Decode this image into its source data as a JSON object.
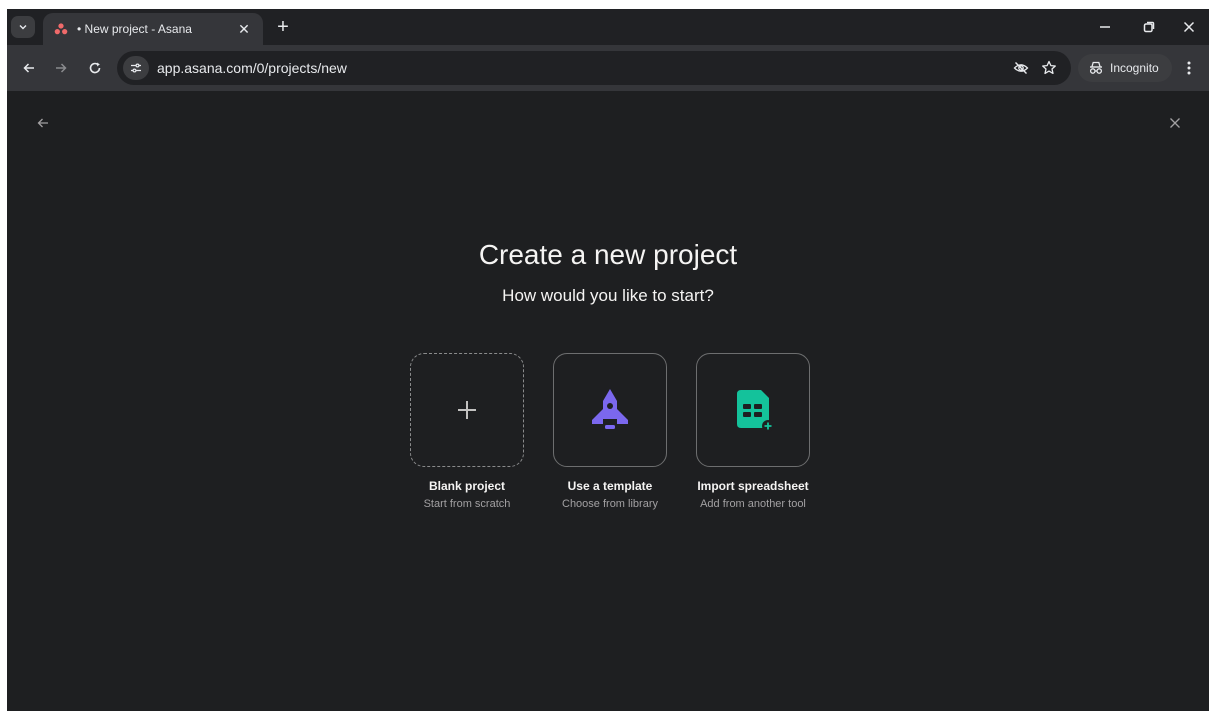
{
  "browser": {
    "tab": {
      "title": "• New project - Asana"
    },
    "new_tab_symbol": "+",
    "url": "app.asana.com/0/projects/new",
    "incognito_label": "Incognito"
  },
  "page": {
    "heading": "Create a new project",
    "subheading": "How would you like to start?",
    "options": [
      {
        "label": "Blank project",
        "sub": "Start from scratch",
        "icon": "plus-icon"
      },
      {
        "label": "Use a template",
        "sub": "Choose from library",
        "icon": "rocket-icon",
        "color": "#7b68ee"
      },
      {
        "label": "Import spreadsheet",
        "sub": "Add from another tool",
        "icon": "spreadsheet-icon",
        "color": "#14c29b"
      }
    ]
  },
  "colors": {
    "asana_brand": "#f06a6a",
    "template_accent": "#7b68ee",
    "import_accent": "#14c29b"
  }
}
